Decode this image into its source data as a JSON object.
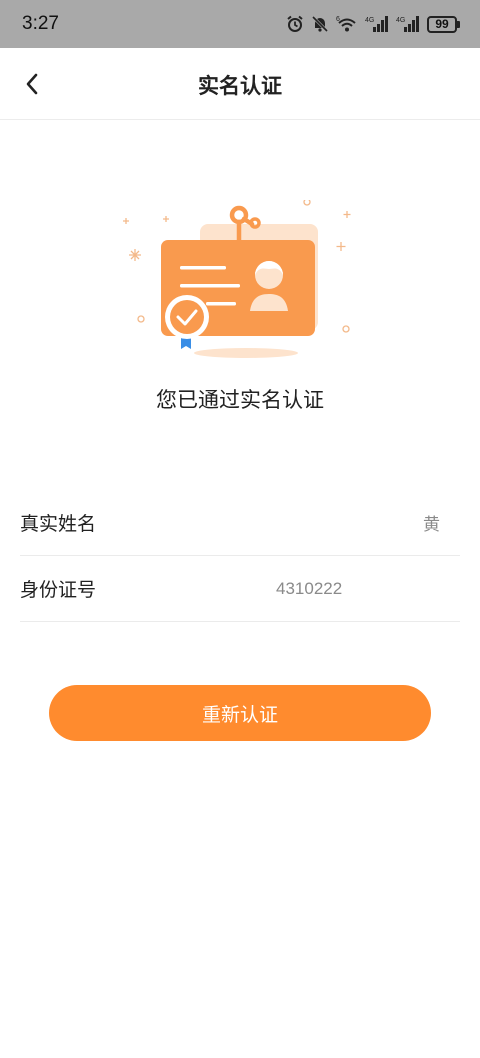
{
  "status_bar": {
    "time": "3:27",
    "battery": "99",
    "network_1": "4G",
    "network_2": "4G",
    "wifi_badge": "6"
  },
  "nav": {
    "title": "实名认证"
  },
  "main": {
    "verified_message": "您已通过实名认证",
    "rows": [
      {
        "label": "真实姓名",
        "value": "黄"
      },
      {
        "label": "身份证号",
        "value": "4310222"
      }
    ],
    "reverify_label": "重新认证"
  },
  "colors": {
    "accent": "#ff8b2e",
    "card": "#f99a4e",
    "card_back": "#fde3cd",
    "status_bar": "#a9a9a9",
    "badge_blue": "#3a8ee6"
  }
}
